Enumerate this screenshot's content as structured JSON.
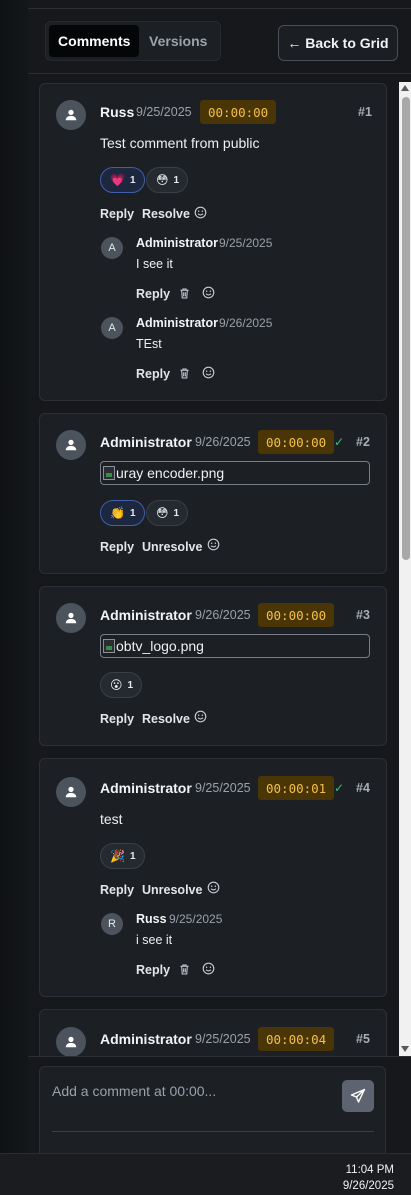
{
  "tabs": [
    {
      "label": "Comments",
      "active": true
    },
    {
      "label": "Versions",
      "active": false
    }
  ],
  "back_button": "← Back to Grid",
  "comments": [
    {
      "author": "Russ",
      "date": "9/25/2025",
      "timecode": "00:00:00",
      "resolved": false,
      "number": "#1",
      "text": "Test comment from public",
      "reactions": [
        {
          "emoji": "💗",
          "count": "1",
          "mine": true
        },
        {
          "emoji": "😳",
          "count": "1",
          "mine": false
        }
      ],
      "actions": {
        "reply": "Reply",
        "resolve": "Resolve"
      },
      "replies": [
        {
          "initial": "A",
          "author": "Administrator",
          "date": "9/25/2025",
          "text": "I see it",
          "reply": "Reply"
        },
        {
          "initial": "A",
          "author": "Administrator",
          "date": "9/26/2025",
          "text": "TEst",
          "reply": "Reply"
        }
      ]
    },
    {
      "author": "Administrator",
      "date": "9/26/2025",
      "timecode": "00:00:00",
      "resolved": true,
      "number": "#2",
      "image_alt": "uray encoder.png",
      "reactions": [
        {
          "emoji": "👏",
          "count": "1",
          "mine": true
        },
        {
          "emoji": "😳",
          "count": "1",
          "mine": false
        }
      ],
      "actions": {
        "reply": "Reply",
        "resolve": "Unresolve"
      }
    },
    {
      "author": "Administrator",
      "date": "9/26/2025",
      "timecode": "00:00:00",
      "resolved": false,
      "number": "#3",
      "image_alt": "obtv_logo.png",
      "reactions": [
        {
          "emoji": "😮",
          "count": "1",
          "mine": false
        }
      ],
      "actions": {
        "reply": "Reply",
        "resolve": "Resolve"
      }
    },
    {
      "author": "Administrator",
      "date": "9/25/2025",
      "timecode": "00:00:01",
      "resolved": true,
      "number": "#4",
      "text": "test",
      "reactions": [
        {
          "emoji": "🎉",
          "count": "1",
          "mine": false
        }
      ],
      "actions": {
        "reply": "Reply",
        "resolve": "Unresolve"
      },
      "replies": [
        {
          "initial": "R",
          "author": "Russ",
          "date": "9/25/2025",
          "text": "i see it",
          "reply": "Reply"
        }
      ]
    },
    {
      "author": "Administrator",
      "date": "9/25/2025",
      "timecode": "00:00:04",
      "resolved": false,
      "number": "#5"
    }
  ],
  "check_mark": "✓",
  "composer": {
    "placeholder": "Add a comment at 00:00..."
  },
  "taskbar": {
    "time": "11:04 PM",
    "date": "9/26/2025"
  },
  "colors": {
    "timecode_bg": "#4a3507",
    "timecode_fg": "#f5c04a",
    "resolved_check": "#3ac27a",
    "my_reaction_border": "#3f5fa8"
  }
}
